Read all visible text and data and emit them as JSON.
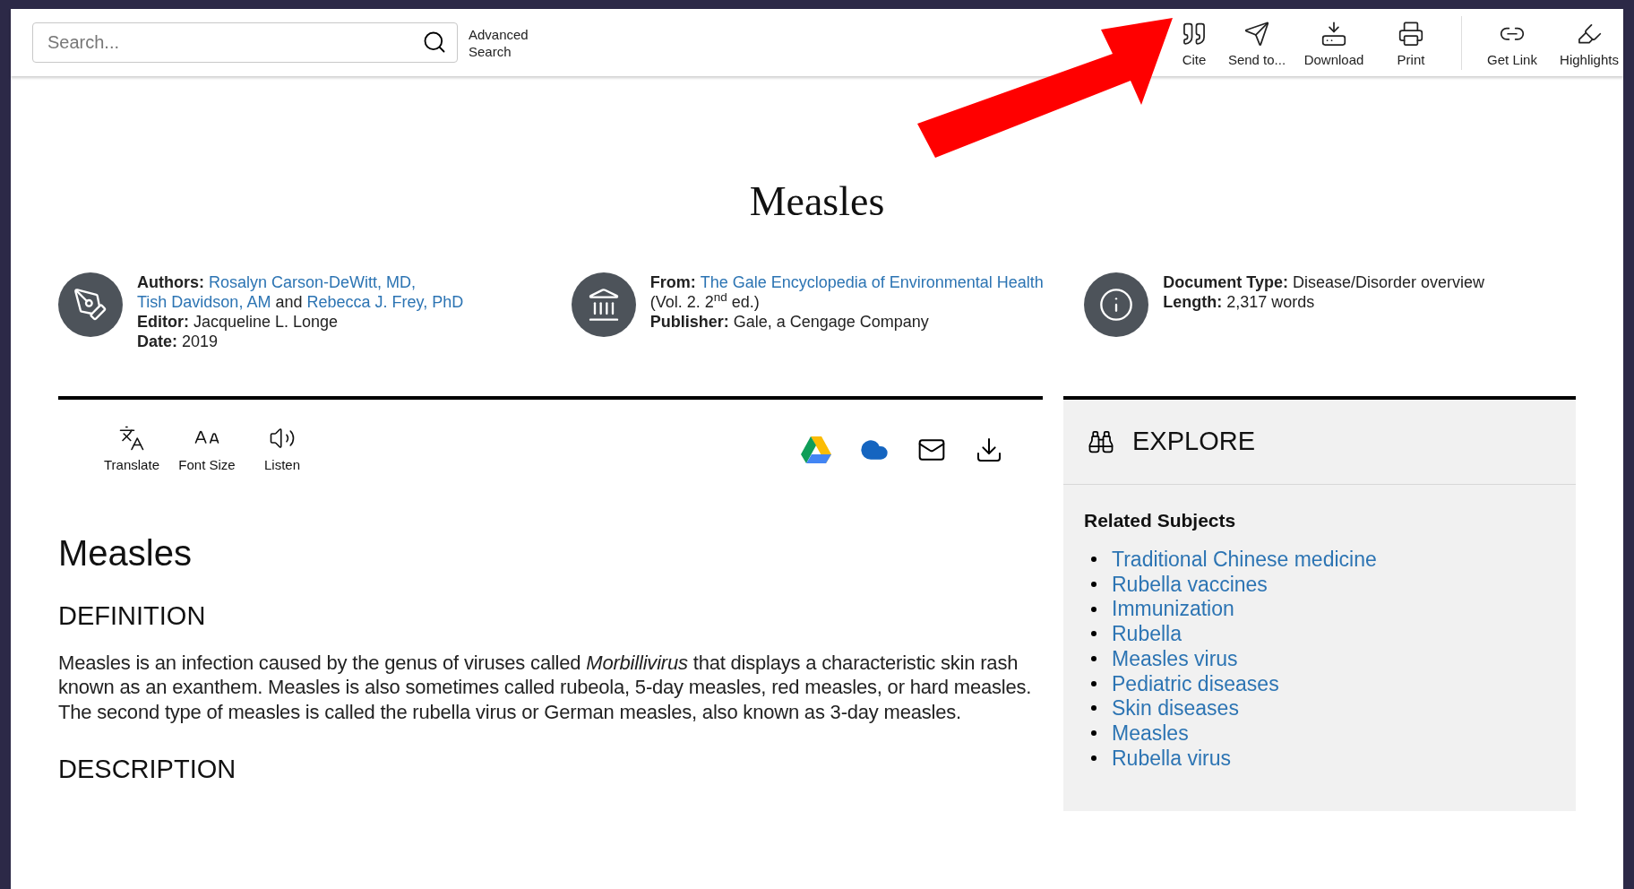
{
  "header": {
    "search": {
      "placeholder": "Search..."
    },
    "advanced_search": "Advanced Search",
    "tools": [
      {
        "kind": "cite",
        "label": "Cite"
      },
      {
        "kind": "send",
        "label": "Send to..."
      },
      {
        "kind": "download",
        "label": "Download"
      },
      {
        "kind": "print",
        "label": "Print"
      },
      {
        "kind": "link",
        "label": "Get Link"
      },
      {
        "kind": "highlights",
        "label": "Highlights"
      }
    ]
  },
  "document_title": "Measles",
  "meta": [
    {
      "kind": "authors",
      "lines": [
        {
          "label": "Authors:",
          "parts": [
            {
              "kind": "link",
              "text": "Rosalyn Carson-DeWitt, MD,"
            },
            {
              "kind": "link",
              "text": "Tish Davidson, AM"
            },
            {
              "kind": "text",
              "text": "and"
            },
            {
              "kind": "link",
              "text": "Rebecca J. Frey, PhD"
            }
          ]
        },
        {
          "label": "Editor:",
          "parts": [
            {
              "kind": "text",
              "text": "Jacqueline L. Longe"
            }
          ]
        },
        {
          "label": "Date:",
          "parts": [
            {
              "kind": "text",
              "text": "2019"
            }
          ]
        }
      ]
    },
    {
      "kind": "source",
      "lines": [
        {
          "label": "From:",
          "parts": [
            {
              "kind": "link",
              "text": "The Gale Encyclopedia of Environmental"
            },
            {
              "kind": "link",
              "text": "Health"
            },
            {
              "kind": "text",
              "text": "(Vol. 2. 2$^{nd}$ ed.)"
            }
          ]
        },
        {
          "label": "Publisher:",
          "parts": [
            {
              "kind": "text",
              "text": "Gale, a Cengage Company"
            }
          ]
        }
      ]
    },
    {
      "kind": "info",
      "lines": [
        {
          "label": "Document Type:",
          "parts": [
            {
              "kind": "text",
              "text": "Disease/Disorder overview"
            }
          ]
        },
        {
          "label": "Length:",
          "parts": [
            {
              "kind": "text",
              "text": "2,317 words"
            }
          ]
        }
      ]
    }
  ],
  "article_tools": [
    {
      "kind": "translate",
      "label": "Translate"
    },
    {
      "kind": "font_size",
      "label": "Font Size"
    },
    {
      "kind": "listen",
      "label": "Listen"
    }
  ],
  "share_tools": [
    {
      "kind": "drive"
    },
    {
      "kind": "cloud"
    },
    {
      "kind": "email"
    },
    {
      "kind": "download"
    }
  ],
  "article": {
    "heading": "Measles",
    "sections": [
      {
        "heading": "DEFINITION",
        "paragraphs": [
          "Measles is an infection caused by the genus of viruses called *Morbillivirus* that displays a characteristic skin rash known as an exanthem. Measles is also sometimes called rubeola, 5-day measles, red measles, or hard measles. The second type of measles is called the rubella virus or German measles, also known as 3-day measles."
        ]
      },
      {
        "heading": "DESCRIPTION"
      }
    ]
  },
  "explore": {
    "title": "EXPLORE",
    "related_heading": "Related Subjects",
    "subjects": [
      "Traditional Chinese medicine",
      "Rubella vaccines",
      "Immunization",
      "Rubella",
      "Measles virus",
      "Pediatric diseases",
      "Skin diseases",
      "Measles",
      "Rubella virus"
    ]
  }
}
